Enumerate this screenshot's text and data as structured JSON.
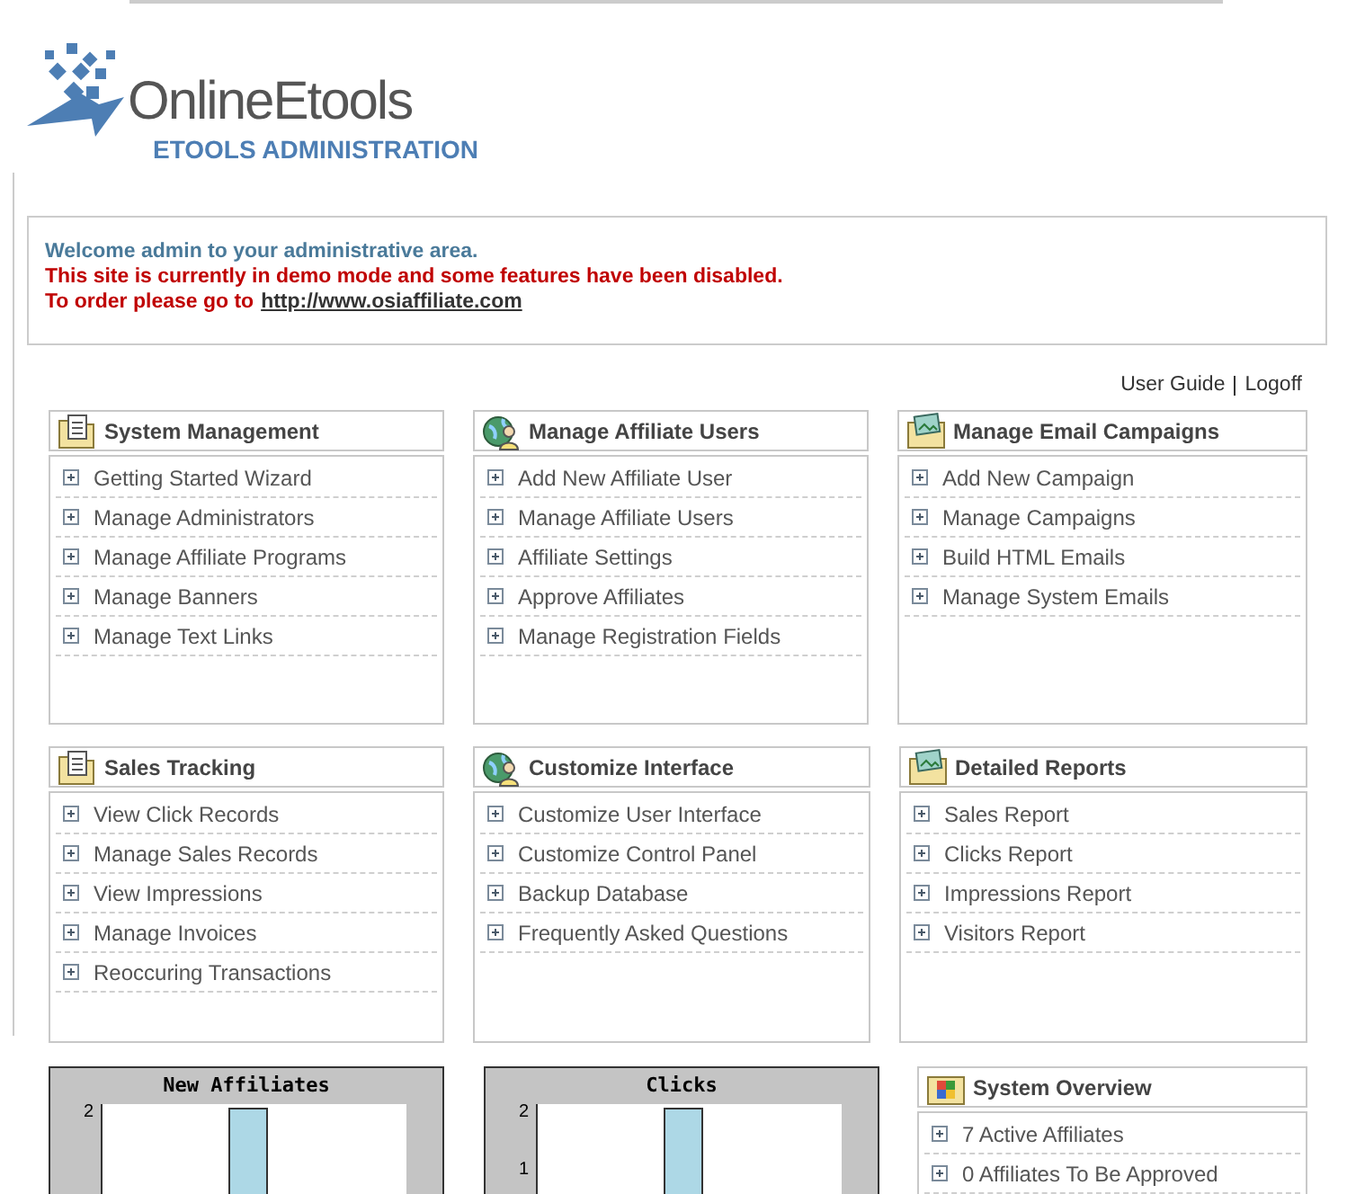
{
  "logo": {
    "name": "OnlineEtools",
    "subtitle": "ETOOLS ADMINISTRATION"
  },
  "notice": {
    "welcome": "Welcome admin to your administrative area.",
    "demo": "This site is currently in demo mode and some features have been disabled.",
    "order": "To order please go to",
    "link": "http://www.osiaffiliate.com"
  },
  "top_links": [
    {
      "label": "User Guide"
    },
    {
      "label": "Logoff"
    }
  ],
  "panels": [
    {
      "title": "System Management",
      "items": [
        "Getting Started Wizard",
        "Manage Administrators",
        "Manage Affiliate Programs",
        "Manage Banners",
        "Manage Text Links"
      ]
    },
    {
      "title": "Manage Affiliate Users",
      "items": [
        "Add New Affiliate User",
        "Manage Affiliate Users",
        "Affiliate Settings",
        "Approve Affiliates",
        "Manage Registration Fields"
      ]
    },
    {
      "title": "Manage Email Campaigns",
      "items": [
        "Add New Campaign",
        "Manage Campaigns",
        "Build HTML Emails",
        "Manage System Emails"
      ]
    },
    {
      "title": "Sales Tracking",
      "items": [
        "View Click Records",
        "Manage Sales Records",
        "View Impressions",
        "Manage Invoices",
        "Reoccuring Transactions"
      ]
    },
    {
      "title": "Customize Interface",
      "items": [
        "Customize User Interface",
        "Customize Control Panel",
        "Backup Database",
        "Frequently Asked Questions"
      ]
    },
    {
      "title": "Detailed Reports",
      "items": [
        "Sales Report",
        "Clicks Report",
        "Impressions Report",
        "Visitors Report"
      ]
    }
  ],
  "charts": [
    {
      "title": "New Affiliates",
      "tick_labels": [
        "2"
      ]
    },
    {
      "title": "Clicks",
      "tick_labels": [
        "2",
        "1"
      ]
    }
  ],
  "overview": {
    "title": "System Overview",
    "items": [
      "7 Active Affiliates",
      "0 Affiliates To Be Approved"
    ]
  }
}
